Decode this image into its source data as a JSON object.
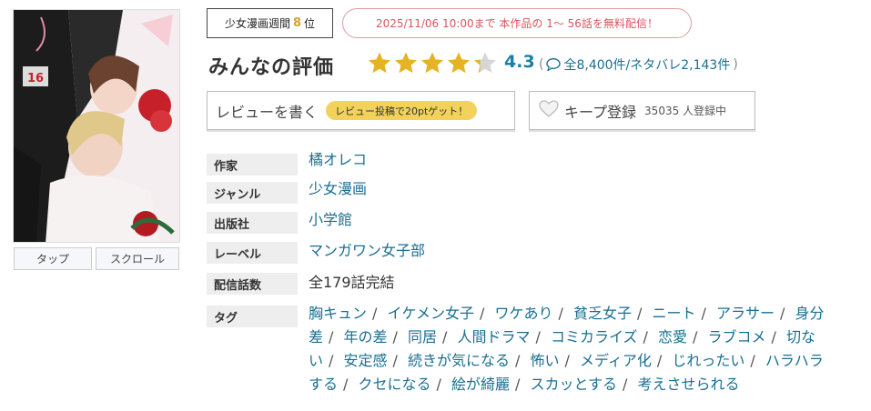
{
  "view_buttons": {
    "tap": "タップ",
    "scroll": "スクロール"
  },
  "rank": {
    "prefix": "少女漫画週間",
    "number": "8",
    "suffix": "位"
  },
  "free_notice": "2025/11/06 10:00まで 本作品の 1～ 56話を無料配信！",
  "rating": {
    "title": "みんなの評価",
    "score": "4.3",
    "open_paren": "(",
    "counts": "全8,400件/ネタバレ2,143件",
    "close_paren": ")",
    "star_value": 4.3,
    "star_color": "#e6b422",
    "star_empty_color": "#d6d6d6"
  },
  "review_button": {
    "label": "レビューを書く",
    "badge": "レビュー投稿で20ptゲット！"
  },
  "keep_button": {
    "label": "キープ登録",
    "count": "35035 人登録中"
  },
  "info": {
    "author_label": "作家",
    "author": "橘オレコ",
    "genre_label": "ジャンル",
    "genre": "少女漫画",
    "publisher_label": "出版社",
    "publisher": "小学館",
    "label_label": "レーベル",
    "label": "マンガワン女子部",
    "episodes_label": "配信話数",
    "episodes": "全179話完結",
    "tags_label": "タグ"
  },
  "tags": [
    "胸キュン",
    "イケメン女子",
    "ワケあり",
    "貧乏女子",
    "ニート",
    "アラサー",
    "身分差",
    "年の差",
    "同居",
    "人間ドラマ",
    "コミカライズ",
    "恋愛",
    "ラブコメ",
    "切ない",
    "安定感",
    "続きが気になる",
    "怖い",
    "メディア化",
    "じれったい",
    "ハラハラする",
    "クセになる",
    "絵が綺麗",
    "スカッとする",
    "考えさせられる"
  ],
  "tag_separator": "/",
  "cover": {
    "volume": "16"
  },
  "colors": {
    "link": "#1a6f90",
    "score": "#1a7fa5",
    "rank_number": "#d7a12d",
    "free_notice": "#d85560",
    "badge_yellow": "#f3d25c"
  }
}
